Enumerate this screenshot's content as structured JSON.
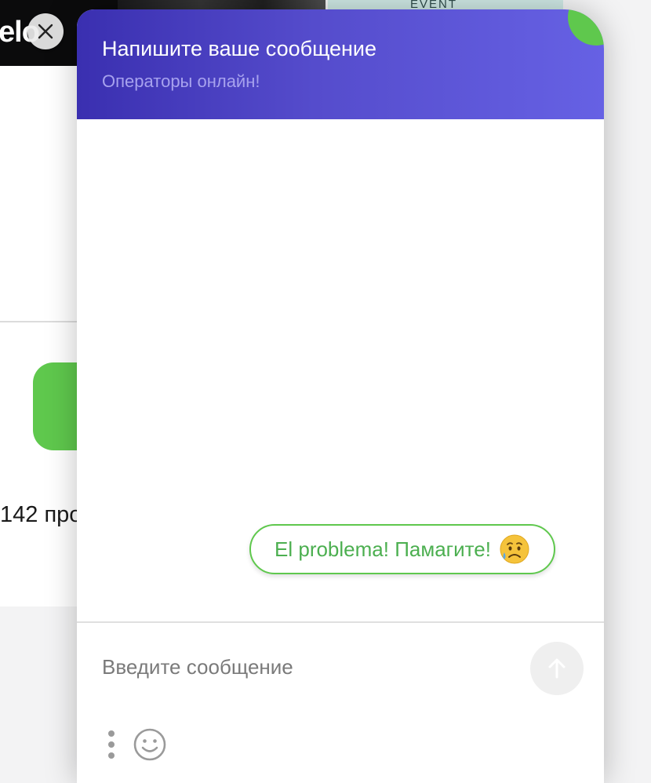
{
  "background_page": {
    "title_fragment": "elo",
    "event_label": "EVENT",
    "count_fragment": "142 про"
  },
  "chat": {
    "title": "Напишите ваше сообщение",
    "subtitle": "Операторы онлайн!",
    "messages": [
      {
        "text": "El problema! Памагите!",
        "emoji": "sad-tear-emoji"
      }
    ],
    "composer": {
      "placeholder": "Введите сообщение"
    },
    "colors": {
      "header_start": "#3a2fb0",
      "header_end": "#6661e4",
      "accent_green": "#5fc84d",
      "message_text": "#4caf50"
    },
    "icons": [
      "close-icon",
      "send-arrow-icon",
      "menu-dots-icon",
      "smiley-icon",
      "status-dot"
    ]
  }
}
